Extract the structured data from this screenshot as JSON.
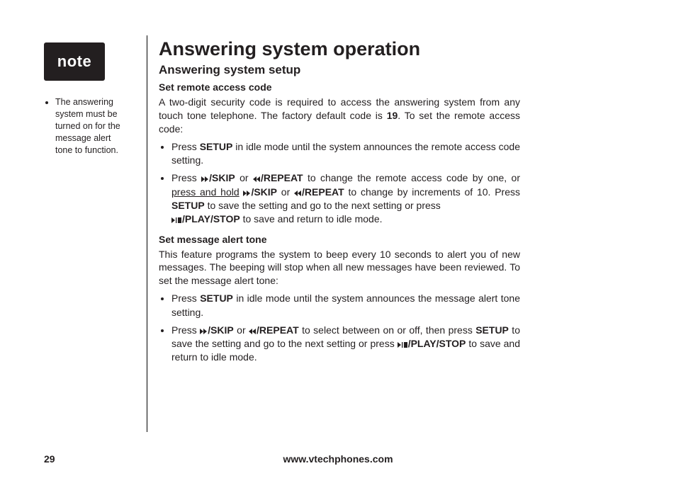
{
  "sidebar": {
    "note_label": "note",
    "items": [
      "The answering system must be turned on for the message alert tone to function."
    ]
  },
  "content": {
    "title": "Answering system operation",
    "subtitle": "Answering system setup",
    "section1": {
      "heading": "Set remote access code",
      "intro_a": "A two-digit security code is required to access the answering system from any touch tone telephone. The factory default code is ",
      "intro_code": "19",
      "intro_b": ". To set the remote access code:",
      "b1_a": "Press ",
      "b1_setup": "SETUP",
      "b1_b": " in idle mode until the system announces the remote access code setting.",
      "b2_a": "Press ",
      "b2_skip": "/SKIP",
      "b2_or": " or ",
      "b2_repeat": "/REPEAT",
      "b2_b": " to change the remote access code by one, or ",
      "b2_ph": "press and hold",
      "b2_c": " ",
      "b2_d": " to change by increments of 10. Press ",
      "b2_setup": "SETUP",
      "b2_e": " to save the setting and go to the next setting or press ",
      "b2_play": "/PLAY/STOP",
      "b2_f": " to save and return to idle mode."
    },
    "section2": {
      "heading": "Set message alert tone",
      "intro": "This feature programs the system to beep every 10 seconds to alert you of new messages. The beeping will stop when all new messages have been reviewed. To set the message alert tone:",
      "b1_a": "Press ",
      "b1_setup": "SETUP",
      "b1_b": " in idle mode until the system announces the message alert tone setting.",
      "b2_a": "Press ",
      "b2_skip": "/SKIP",
      "b2_or": " or ",
      "b2_repeat": "/REPEAT",
      "b2_b": " to select between on or off, then press ",
      "b2_setup": "SETUP",
      "b2_c": " to save the setting and go to the next setting or press ",
      "b2_play": "/PLAY/STOP",
      "b2_d": " to save and return to idle mode."
    }
  },
  "footer": {
    "page": "29",
    "site": "www.vtechphones.com"
  }
}
